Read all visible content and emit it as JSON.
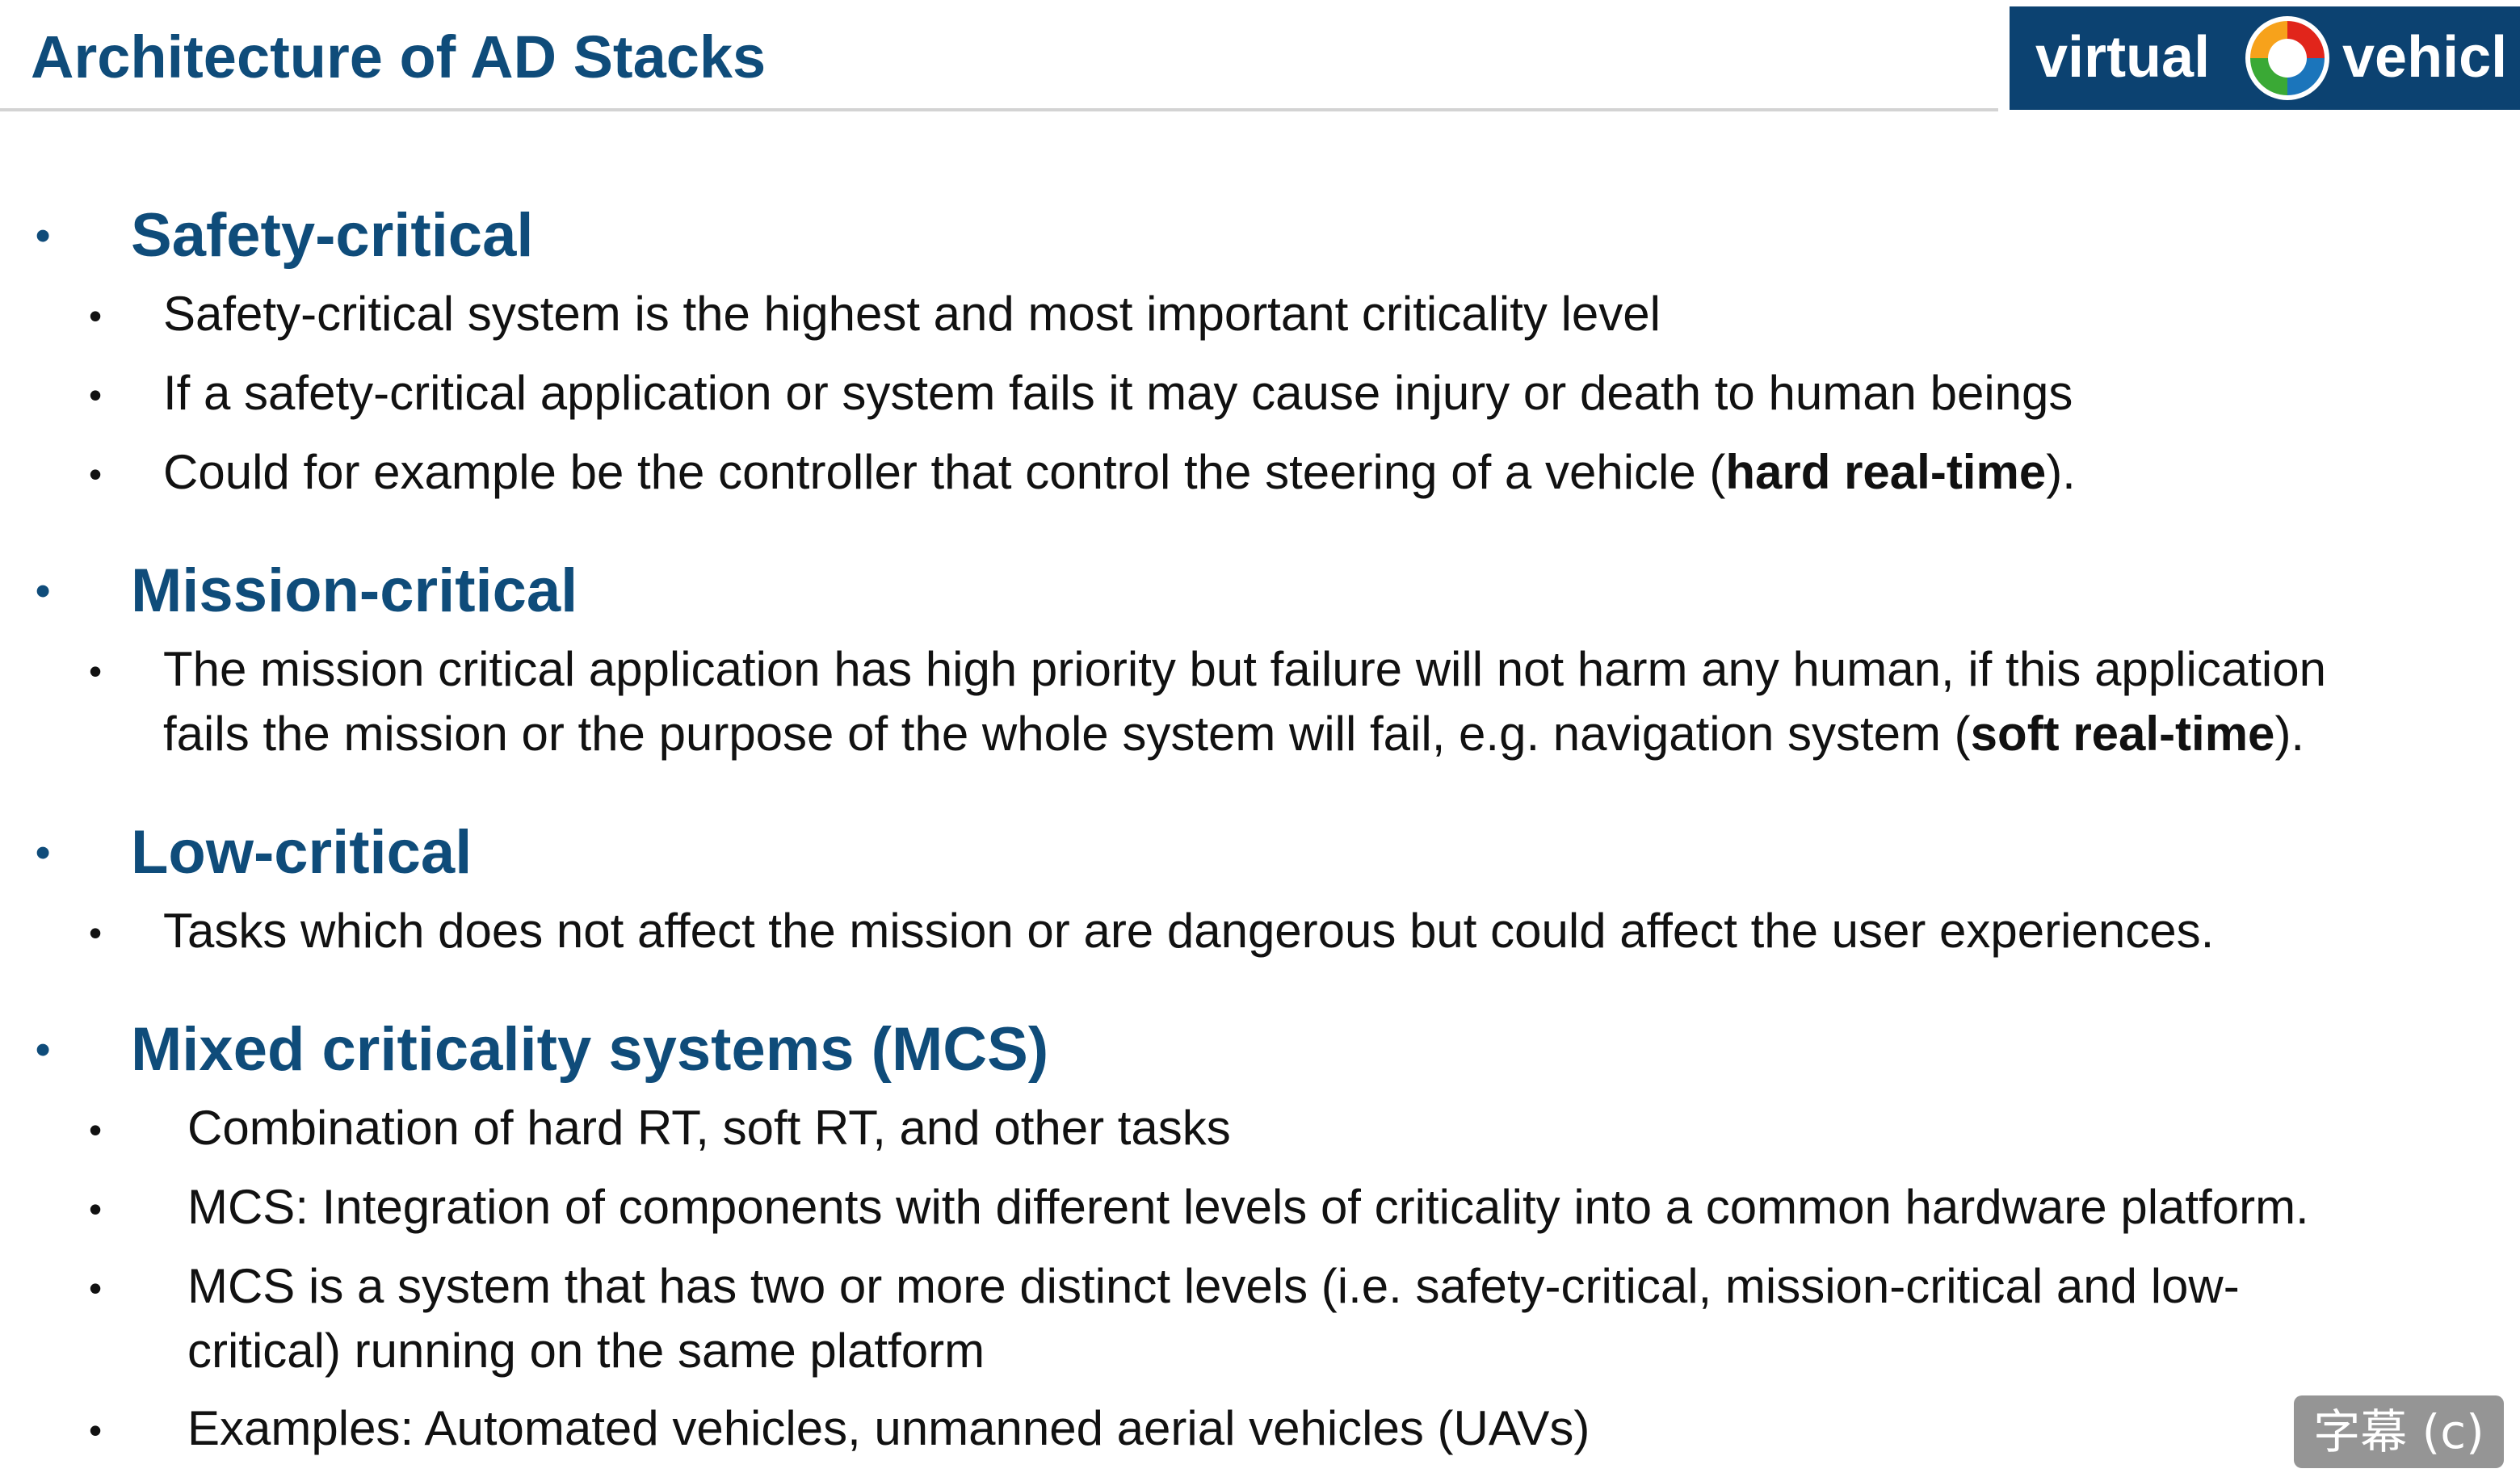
{
  "header": {
    "title": "Architecture of AD Stacks",
    "logo_left": "virtual",
    "logo_right": "vehicl",
    "logo_colors": {
      "bg": "#0c4271",
      "red": "#e1251b",
      "orange": "#f7a21b",
      "green": "#3aa935",
      "blue": "#1b75bb"
    }
  },
  "sections": [
    {
      "heading": "Safety-critical",
      "items": [
        {
          "lines": [
            {
              "pre": "Safety-critical system is the highest and most important criticality level",
              "bold": "",
              "post": ""
            }
          ]
        },
        {
          "lines": [
            {
              "pre": "If a safety-critical application or system fails it may cause injury or death to human beings",
              "bold": "",
              "post": ""
            }
          ]
        },
        {
          "lines": [
            {
              "pre": "Could for example be the controller that control the steering of a vehicle (",
              "bold": "hard real-time",
              "post": ")."
            }
          ]
        }
      ]
    },
    {
      "heading": "Mission-critical",
      "items": [
        {
          "lines": [
            {
              "pre": "The mission critical application has high priority but failure will not harm any human, if this application",
              "bold": "",
              "post": ""
            },
            {
              "pre": "fails the mission or the purpose of the whole system will fail, e.g. navigation system (",
              "bold": "soft real-time",
              "post": ")."
            }
          ]
        }
      ]
    },
    {
      "heading": "Low-critical",
      "items": [
        {
          "lines": [
            {
              "pre": "Tasks which does not affect the mission or are dangerous but could affect the user experiences.",
              "bold": "",
              "post": ""
            }
          ]
        }
      ]
    },
    {
      "heading": "Mixed criticality systems (MCS)",
      "items": [
        {
          "lines": [
            {
              "pre": "Combination of hard RT, soft RT, and other tasks",
              "bold": "",
              "post": ""
            }
          ]
        },
        {
          "lines": [
            {
              "pre": "MCS: Integration of components with different levels of criticality into a common hardware platform.",
              "bold": "",
              "post": ""
            }
          ]
        },
        {
          "lines": [
            {
              "pre": "MCS is a system that has two or more distinct levels (i.e. safety-critical, mission-critical and low-",
              "bold": "",
              "post": ""
            },
            {
              "pre": "critical) running on the same platform",
              "bold": "",
              "post": ""
            }
          ]
        },
        {
          "lines": [
            {
              "pre": "Examples: Automated vehicles, unmanned aerial vehicles (UAVs)",
              "bold": "",
              "post": ""
            }
          ]
        }
      ]
    }
  ],
  "bullet_char": "•",
  "caption_badge": "字幕 (c)"
}
